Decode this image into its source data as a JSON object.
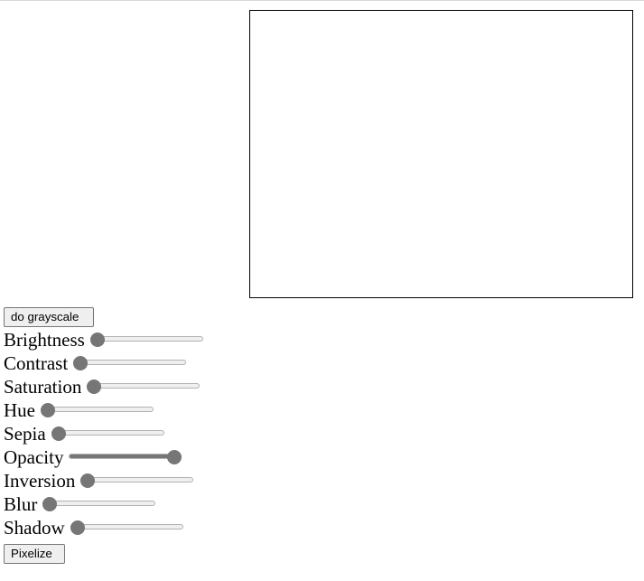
{
  "buttons": {
    "grayscale_label": "do grayscale",
    "pixelize_label": "Pixelize"
  },
  "sliders": [
    {
      "id": "brightness",
      "label": "Brightness",
      "level": 0.0
    },
    {
      "id": "contrast",
      "label": "Contrast",
      "level": 0.0
    },
    {
      "id": "saturation",
      "label": "Saturation",
      "level": 0.0
    },
    {
      "id": "hue",
      "label": "Hue",
      "level": 0.0
    },
    {
      "id": "sepia",
      "label": "Sepia",
      "level": 0.0
    },
    {
      "id": "opacity",
      "label": "Opacity",
      "level": 1.0
    },
    {
      "id": "inversion",
      "label": "Inversion",
      "level": 0.0
    },
    {
      "id": "blur",
      "label": "Blur",
      "level": 0.0
    },
    {
      "id": "shadow",
      "label": "Shadow",
      "level": 0.0
    }
  ],
  "colors": {
    "thumb": "#767676",
    "track": "#efefef",
    "track_border": "#b2b2b2",
    "fill": "#777777",
    "canvas_border": "#000000"
  }
}
